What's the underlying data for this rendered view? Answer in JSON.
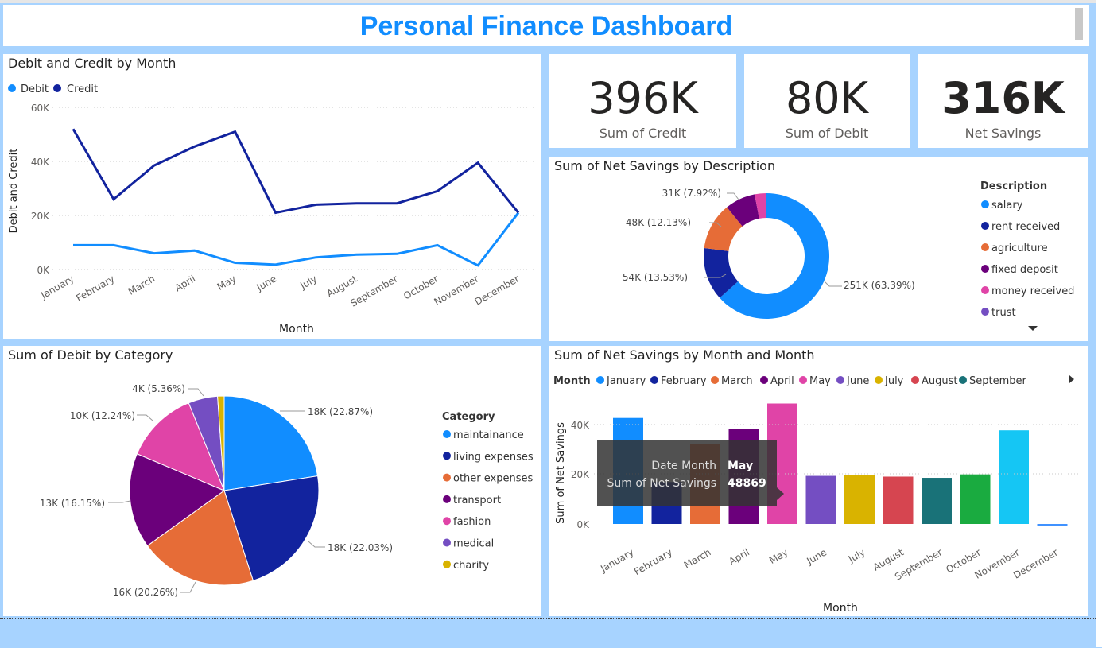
{
  "page": {
    "title": "Personal Finance Dashboard"
  },
  "colors": {
    "accent": "#118dff",
    "debit": "#118dff",
    "credit": "#12239e",
    "background": "#a7d3ff"
  },
  "kpis": [
    {
      "value": "396K",
      "label": "Sum of Credit"
    },
    {
      "value": "80K",
      "label": "Sum of Debit"
    },
    {
      "value": "316K",
      "label": "Net Savings"
    }
  ],
  "line_chart": {
    "title": "Debit and Credit by Month",
    "legend": [
      "Debit",
      "Credit"
    ],
    "ylabel": "Debit and Credit",
    "xlabel": "Month",
    "yticks": [
      "60K",
      "40K",
      "20K",
      "0K"
    ]
  },
  "donut_chart": {
    "title": "Sum of Net Savings by Description",
    "legend_title": "Description",
    "legend": [
      "salary",
      "rent received",
      "agriculture",
      "fixed deposit",
      "money received",
      "trust"
    ],
    "labels": [
      "251K (63.39%)",
      "54K (13.53%)",
      "48K (12.13%)",
      "31K (7.92%)"
    ]
  },
  "pie_chart": {
    "title": "Sum of Debit by Category",
    "legend_title": "Category",
    "legend": [
      "maintainance",
      "living expenses",
      "other expenses",
      "transport",
      "fashion",
      "medical",
      "charity"
    ],
    "labels": [
      "18K (22.87%)",
      "18K (22.03%)",
      "16K (20.26%)",
      "13K (16.15%)",
      "10K (12.24%)",
      "4K (5.36%)"
    ]
  },
  "bar_chart": {
    "title": "Sum of Net Savings by Month and Month",
    "legend_title": "Month",
    "legend": [
      "January",
      "February",
      "March",
      "April",
      "May",
      "June",
      "July",
      "August",
      "September"
    ],
    "ylabel": "Sum of Net Savings",
    "xlabel": "Month",
    "yticks": [
      "40K",
      "20K",
      "0K"
    ],
    "tooltip": {
      "label1": "Date Month",
      "value1": "May",
      "label2": "Sum of Net Savings",
      "value2": "48869"
    }
  },
  "chart_data": [
    {
      "type": "line",
      "title": "Debit and Credit by Month",
      "x": [
        "January",
        "February",
        "March",
        "April",
        "May",
        "June",
        "July",
        "August",
        "September",
        "October",
        "November",
        "December"
      ],
      "series": [
        {
          "name": "Debit",
          "values": [
            9000,
            9000,
            6000,
            7000,
            2500,
            1800,
            4500,
            5500,
            5800,
            9000,
            1500,
            21000
          ],
          "color": "#118dff"
        },
        {
          "name": "Credit",
          "values": [
            52000,
            26000,
            38500,
            45500,
            51000,
            21000,
            24000,
            24500,
            24500,
            29000,
            39500,
            21000
          ],
          "color": "#12239e"
        }
      ],
      "xlabel": "Month",
      "ylabel": "Debit and Credit",
      "ylim": [
        0,
        60000
      ],
      "grid": true,
      "legend": "top-left"
    },
    {
      "type": "pie",
      "title": "Sum of Net Savings by Description",
      "donut": true,
      "categories": [
        "salary",
        "rent received",
        "agriculture",
        "fixed deposit",
        "money received",
        "trust"
      ],
      "values": [
        251000,
        54000,
        48000,
        31000,
        12000,
        0
      ],
      "percentages": [
        63.39,
        13.53,
        12.13,
        7.92,
        3.03,
        0
      ],
      "colors": [
        "#118dff",
        "#12239e",
        "#e66c37",
        "#6b007b",
        "#e044a7",
        "#744ec2"
      ],
      "legend": "right"
    },
    {
      "type": "pie",
      "title": "Sum of Debit by Category",
      "categories": [
        "maintainance",
        "living expenses",
        "other expenses",
        "transport",
        "fashion",
        "medical",
        "charity"
      ],
      "values": [
        18000,
        18000,
        16000,
        13000,
        10000,
        4000,
        900
      ],
      "percentages": [
        22.87,
        22.03,
        20.26,
        16.15,
        12.24,
        5.36,
        1.09
      ],
      "colors": [
        "#118dff",
        "#12239e",
        "#e66c37",
        "#6b007b",
        "#e044a7",
        "#744ec2",
        "#d9b300"
      ],
      "legend": "right"
    },
    {
      "type": "bar",
      "title": "Sum of Net Savings by Month and Month",
      "categories": [
        "January",
        "February",
        "March",
        "April",
        "May",
        "June",
        "July",
        "August",
        "September",
        "October",
        "November",
        "December"
      ],
      "values": [
        43000,
        17000,
        32500,
        38500,
        48869,
        19500,
        19800,
        19200,
        18700,
        20100,
        38000,
        -500
      ],
      "colors": [
        "#118dff",
        "#12239e",
        "#e66c37",
        "#6b007b",
        "#e044a7",
        "#744ec2",
        "#d9b300",
        "#d64550",
        "#197278",
        "#1aab40",
        "#15c6f4",
        "#4092ff"
      ],
      "xlabel": "Month",
      "ylabel": "Sum of Net Savings",
      "ylim": [
        0,
        50000
      ],
      "grid": true,
      "legend": "top"
    }
  ]
}
